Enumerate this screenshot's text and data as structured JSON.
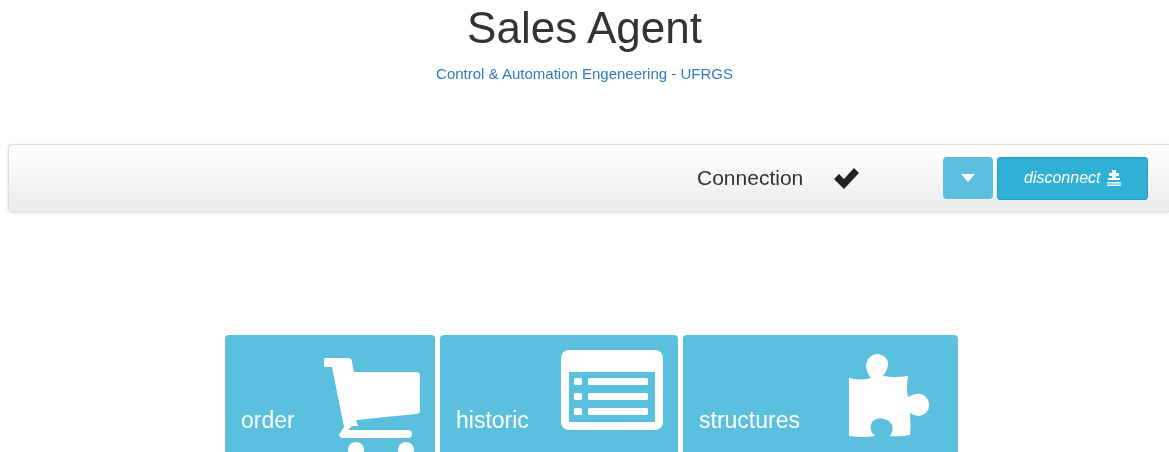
{
  "header": {
    "title": "Sales Agent",
    "subtitle": "Control & Automation Engeneering - UFRGS"
  },
  "navbar": {
    "status_label": "Connection",
    "connected": true,
    "disconnect_button": "disconnect"
  },
  "tiles": [
    {
      "label": "order"
    },
    {
      "label": "historic"
    },
    {
      "label": "structures"
    }
  ]
}
